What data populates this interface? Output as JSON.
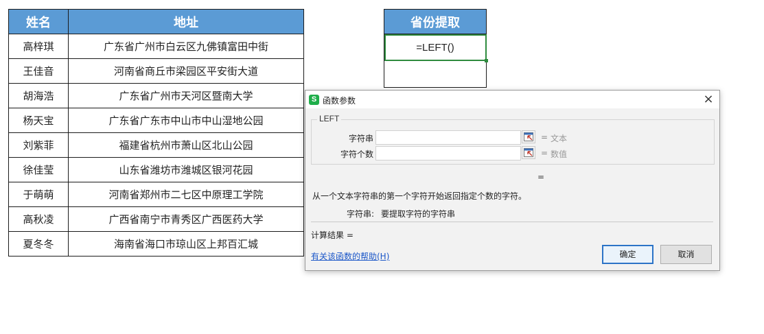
{
  "sheet": {
    "headers": {
      "name": "姓名",
      "address": "地址"
    },
    "rows": [
      {
        "name": "高梓琪",
        "address": "广东省广州市白云区九佛镇富田中街"
      },
      {
        "name": "王佳音",
        "address": "河南省商丘市梁园区平安街大道"
      },
      {
        "name": "胡海浩",
        "address": "广东省广州市天河区暨南大学"
      },
      {
        "name": "杨天宝",
        "address": "广东省广东市中山市中山湿地公园"
      },
      {
        "name": "刘紫菲",
        "address": "福建省杭州市萧山区北山公园"
      },
      {
        "name": "徐佳莹",
        "address": "山东省潍坊市潍城区银河花园"
      },
      {
        "name": "于萌萌",
        "address": "河南省郑州市二七区中原理工学院"
      },
      {
        "name": "高秋凌",
        "address": "广西省南宁市青秀区广西医药大学"
      },
      {
        "name": "夏冬冬",
        "address": "海南省海口市琼山区上邦百汇城"
      }
    ]
  },
  "side": {
    "header": "省份提取",
    "active_cell": "=LEFT()"
  },
  "dialog": {
    "title": "函数参数",
    "app_icon": "S",
    "close_glyph": "×",
    "function_name": "LEFT",
    "args": [
      {
        "label": "字符串",
        "value": "",
        "eq": "=",
        "hint": "文本"
      },
      {
        "label": "字符个数",
        "value": "",
        "eq": "=",
        "hint": "数值"
      }
    ],
    "center_eq": "=",
    "description": "从一个文本字符串的第一个字符开始返回指定个数的字符。",
    "param_label": "字符串:",
    "param_desc": "要提取字符的字符串",
    "result_label": "计算结果 =",
    "help_link": "有关该函数的帮助(H)",
    "ok_label": "确定",
    "cancel_label": "取消"
  },
  "colors": {
    "header_bg": "#5b9bd5",
    "active_cell_border": "#2e8b3e",
    "ok_border": "#2b73c7",
    "link": "#1a56c8",
    "app_icon_bg": "#1fae4a"
  }
}
